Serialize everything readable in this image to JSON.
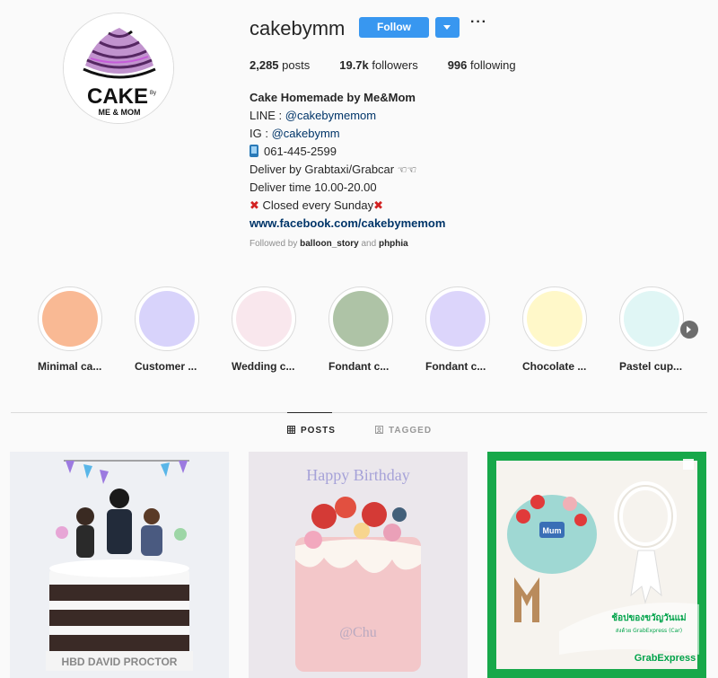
{
  "profile": {
    "username": "cakebymm",
    "follow_label": "Follow",
    "more_label": "···",
    "logo_text": "CAKE",
    "logo_sub": "ME & MOM",
    "logo_by": "By"
  },
  "stats": {
    "posts": "2,285",
    "posts_label": " posts",
    "followers": "19.7k",
    "followers_label": " followers",
    "following": "996",
    "following_label": " following"
  },
  "bio": {
    "name": "Cake Homemade by Me&Mom",
    "line_label": "LINE : ",
    "line_handle": "@cakebymemom",
    "ig_label": "IG : ",
    "ig_handle": "@cakebymm",
    "phone": "061-445-2599",
    "deliver": "Deliver by Grabtaxi/Grabcar",
    "deliver_icons": "☜☜",
    "deliver_time": "Deliver time 10.00-20.00",
    "closed_mark": "✖",
    "closed": "Closed every Sunday",
    "website": "www.facebook.com/cakebymemom"
  },
  "followed_by": {
    "prefix": "Followed by ",
    "user1": "balloon_story",
    "and": " and ",
    "user2": "phphia"
  },
  "highlights": [
    {
      "label": "Minimal ca...",
      "color": "#f9b994"
    },
    {
      "label": "Customer ...",
      "color": "#d8d3fb"
    },
    {
      "label": "Wedding c...",
      "color": "#f9e7ed"
    },
    {
      "label": "Fondant c...",
      "color": "#aec3a6"
    },
    {
      "label": "Fondant c...",
      "color": "#dcd5fb"
    },
    {
      "label": "Chocolate ...",
      "color": "#fff8c9"
    },
    {
      "label": "Pastel cup...",
      "color": "#e0f6f5"
    }
  ],
  "tabs": {
    "posts": "POSTS",
    "tagged": "TAGGED"
  },
  "posts": {
    "p1_text": "HBD DAVID PROCTOR",
    "p2_text": "Happy Birthday",
    "p2_name": "@Chu",
    "p3_text": "ช้อปของขวัญวันแม่",
    "p3_sub": "ส่งด้วย GrabExpress (Car)",
    "p3_brand": "GrabExpress",
    "p3_tag": "Mum"
  },
  "colors": {
    "accent": "#3897f0",
    "link": "#003569",
    "grab_green": "#00b14f"
  }
}
